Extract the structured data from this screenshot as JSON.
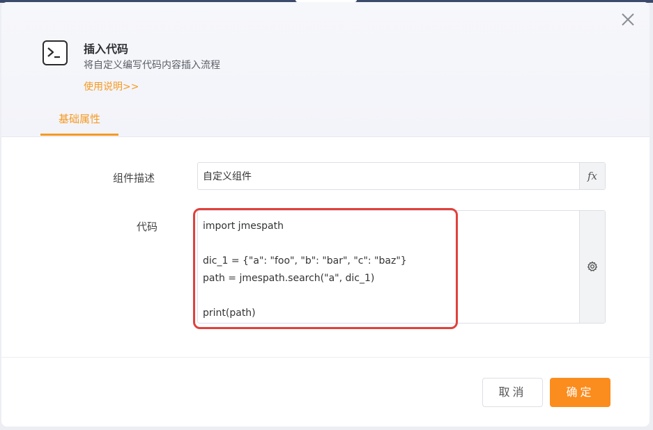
{
  "dialog": {
    "title": "插入代码",
    "subtitle": "将自定义编写代码内容插入流程",
    "usage_link": "使用说明>>",
    "close_icon": "close-icon",
    "title_icon": "terminal-icon"
  },
  "tabs": [
    {
      "label": "基础属性",
      "active": true
    }
  ],
  "form": {
    "description": {
      "label": "组件描述",
      "value": "自定义组件",
      "fx_label": "fx"
    },
    "code": {
      "label": "代码",
      "value": "import jmespath\n\ndic_1 = {\"a\": \"foo\", \"b\": \"bar\", \"c\": \"baz\"}\npath = jmespath.search(\"a\", dic_1)\n\nprint(path)",
      "settings_icon": "gear-icon"
    }
  },
  "footer": {
    "cancel_label": "取消",
    "ok_label": "确定"
  },
  "colors": {
    "accent": "#f59a23",
    "primary_button": "#fb8c1e",
    "highlight": "#e0413c"
  }
}
